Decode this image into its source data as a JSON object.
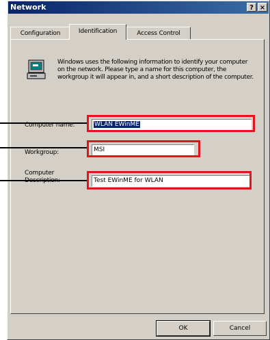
{
  "window": {
    "title": "Network",
    "help_glyph": "?",
    "close_glyph": "×"
  },
  "tabs": [
    {
      "label": "Configuration",
      "active": false
    },
    {
      "label": "Identification",
      "active": true
    },
    {
      "label": "Access Control",
      "active": false
    }
  ],
  "identification": {
    "description": "Windows uses the following information to identify your computer on the network. Please type a name for this computer, the workgroup it will appear in, and a short description of the computer.",
    "icon": "computer-icon",
    "computer_name": {
      "label": "Computer name:",
      "value": "WLAN EWinME"
    },
    "workgroup": {
      "label": "Workgroup:",
      "value": "MSI"
    },
    "computer_description": {
      "label_line1": "Computer",
      "label_line2": "Description:",
      "value": "Test EWinME for WLAN"
    }
  },
  "buttons": {
    "ok": "OK",
    "cancel": "Cancel"
  },
  "colors": {
    "highlight": "#e4141e",
    "titlebar": "#0a246a",
    "face": "#d4d0c8"
  }
}
